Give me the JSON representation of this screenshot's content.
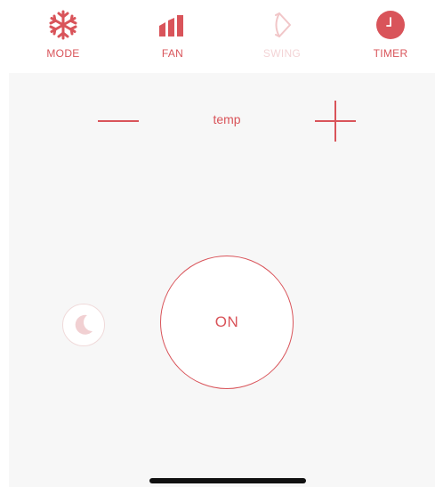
{
  "toolbar": {
    "mode": {
      "label": "MODE",
      "icon": "snowflake-icon"
    },
    "fan": {
      "label": "FAN",
      "icon": "fan-speed-bars-icon"
    },
    "swing": {
      "label": "SWING",
      "icon": "swing-icon",
      "enabled": false
    },
    "timer": {
      "label": "TIMER",
      "icon": "clock-icon"
    }
  },
  "temperature": {
    "label": "temp",
    "decrease_icon": "minus-icon",
    "increase_icon": "plus-icon"
  },
  "sleep": {
    "icon": "moon-icon"
  },
  "power": {
    "label": "ON"
  },
  "colors": {
    "accent": "#d9545a",
    "accent_faded": "#f3d4d6",
    "panel_background": "#f7f7f7",
    "background": "#ffffff"
  }
}
